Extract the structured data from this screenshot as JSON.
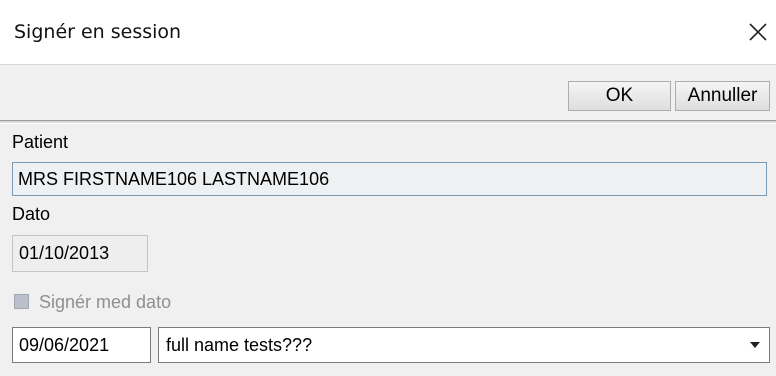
{
  "window": {
    "title": "Signér en session"
  },
  "toolbar": {
    "ok_label": "OK",
    "cancel_label": "Annuller"
  },
  "form": {
    "patient_label": "Patient",
    "patient_value": "MRS FIRSTNAME106 LASTNAME106",
    "dato_label": "Dato",
    "dato_value": "01/10/2013",
    "sign_with_date_label": "Signér med dato",
    "sign_with_date_checked": false,
    "sign_date_value": "09/06/2021",
    "signer_value": "full name tests???"
  },
  "icons": {
    "close": "close-icon",
    "dropdown": "chevron-down-icon"
  }
}
